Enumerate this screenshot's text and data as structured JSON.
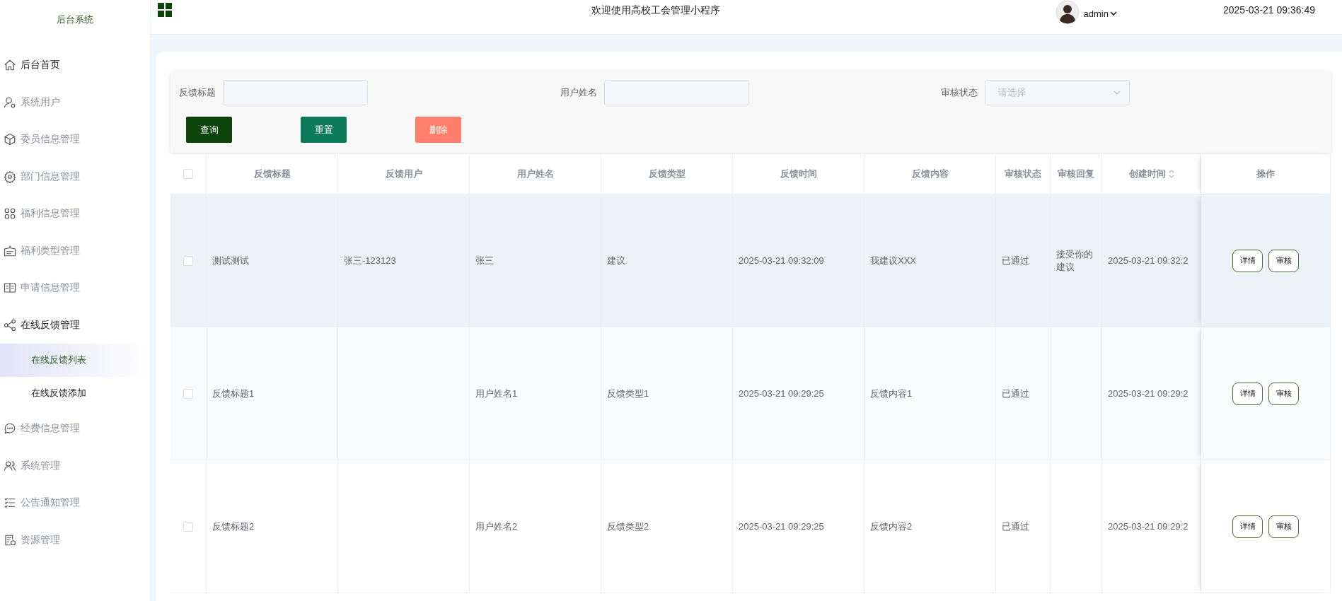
{
  "sidebar": {
    "title": "后台系统",
    "items": [
      {
        "label": "后台首页",
        "hovered": true,
        "expanded": false
      },
      {
        "label": "系统用户",
        "hovered": false,
        "expanded": false
      },
      {
        "label": "委员信息管理",
        "hovered": false,
        "expanded": false
      },
      {
        "label": "部门信息管理",
        "hovered": false,
        "expanded": false
      },
      {
        "label": "福利信息管理",
        "hovered": false,
        "expanded": false
      },
      {
        "label": "福利类型管理",
        "hovered": false,
        "expanded": false
      },
      {
        "label": "申请信息管理",
        "hovered": false,
        "expanded": false
      },
      {
        "label": "在线反馈管理",
        "hovered": false,
        "expanded": true,
        "children": [
          {
            "label": "在线反馈列表",
            "selected": true
          },
          {
            "label": "在线反馈添加",
            "selected": false
          }
        ]
      },
      {
        "label": "经费信息管理",
        "hovered": false,
        "expanded": false
      },
      {
        "label": "系统管理",
        "hovered": false,
        "expanded": false
      },
      {
        "label": "公告通知管理",
        "hovered": false,
        "expanded": false
      },
      {
        "label": "资源管理",
        "hovered": false,
        "expanded": false
      }
    ]
  },
  "header": {
    "title": "欢迎使用高校工会管理小程序",
    "user": "admin",
    "datetime": "2025-03-21 09:36:49"
  },
  "filters": [
    {
      "label": "反馈标题",
      "kind": "input"
    },
    {
      "label": "用户姓名",
      "kind": "input"
    },
    {
      "label": "审核状态",
      "kind": "select",
      "placeholder": "请选择"
    }
  ],
  "buttons": [
    {
      "label": "查询",
      "kind": "search",
      "disabled": false
    },
    {
      "label": "重置",
      "kind": "reset",
      "disabled": false
    },
    {
      "label": "删除",
      "kind": "delete",
      "disabled": true
    }
  ],
  "table": {
    "all_checked": false,
    "columns": [
      "反馈标题",
      "反馈用户",
      "用户姓名",
      "反馈类型",
      "反馈时间",
      "反馈内容",
      "审核状态",
      "审核回复",
      "创建时间",
      "操作"
    ],
    "rows": [
      {
        "checked": false,
        "hovered": true,
        "cells": [
          "测试测试",
          "张三-123123",
          "张三",
          "建议",
          "2025-03-21 09:32:09",
          "我建议XXX",
          "已通过",
          "接受你的建议",
          "2025-03-21 09:32:2"
        ],
        "actions": [
          "详情",
          "审核"
        ]
      },
      {
        "checked": false,
        "hovered": false,
        "cells": [
          "反馈标题1",
          "",
          "用户姓名1",
          "反馈类型1",
          "2025-03-21 09:29:25",
          "反馈内容1",
          "已通过",
          "",
          "2025-03-21 09:29:2"
        ],
        "actions": [
          "详情",
          "审核"
        ]
      },
      {
        "checked": false,
        "hovered": false,
        "cells": [
          "反馈标题2",
          "",
          "用户姓名2",
          "反馈类型2",
          "2025-03-21 09:29:25",
          "反馈内容2",
          "已通过",
          "",
          "2025-03-21 09:29:2"
        ],
        "actions": [
          "详情",
          "审核"
        ]
      }
    ]
  }
}
